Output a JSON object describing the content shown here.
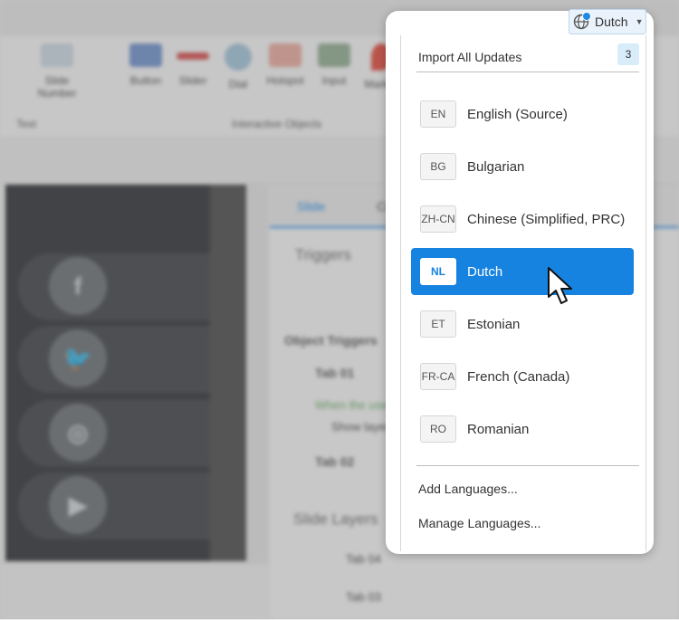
{
  "language_button": {
    "label": "Dutch",
    "icon": "globe-icon"
  },
  "menu": {
    "import": {
      "label": "Import All Updates",
      "count": "3"
    },
    "languages": [
      {
        "code": "EN",
        "name": "English (Source)",
        "selected": false
      },
      {
        "code": "BG",
        "name": "Bulgarian",
        "selected": false
      },
      {
        "code": "ZH-CN",
        "name": "Chinese (Simplified, PRC)",
        "selected": false
      },
      {
        "code": "NL",
        "name": "Dutch",
        "selected": true
      },
      {
        "code": "ET",
        "name": "Estonian",
        "selected": false
      },
      {
        "code": "FR-CA",
        "name": "French (Canada)",
        "selected": false
      },
      {
        "code": "RO",
        "name": "Romanian",
        "selected": false
      }
    ],
    "add_languages": "Add Languages...",
    "manage_languages": "Manage Languages..."
  },
  "background": {
    "ribbon_tools": [
      "Slide Number",
      "Button",
      "Slider",
      "Dial",
      "Hotspot",
      "Input",
      "Marker"
    ],
    "ribbon_groups": [
      "Text",
      "Interactive Objects"
    ],
    "panel_tabs": [
      "Slide",
      "Co"
    ],
    "triggers_title": "Triggers",
    "object_triggers": "Object Triggers",
    "tab1": "Tab 01",
    "tab2": "Tab 02",
    "when_user": "When the user",
    "show_layer": "Show layer",
    "slide_layers": "Slide Layers",
    "layer4": "Tab 04",
    "layer3": "Tab 03"
  },
  "colors": {
    "accent": "#1683e0",
    "badge_bg": "#d8ecfa"
  }
}
